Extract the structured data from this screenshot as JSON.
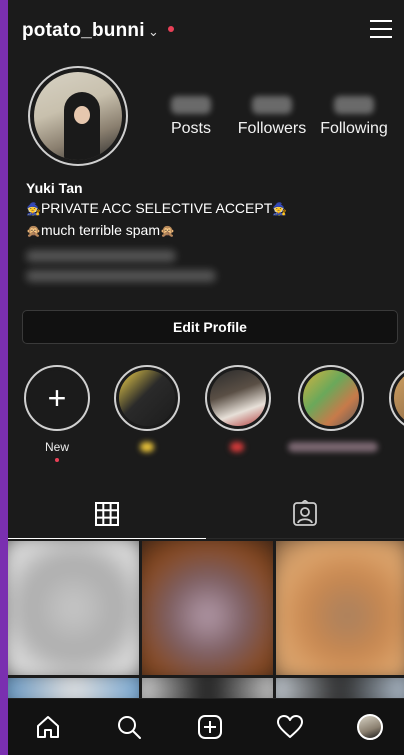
{
  "header": {
    "username": "potato_bunni",
    "caret": "⌄"
  },
  "stats": {
    "posts_label": "Posts",
    "followers_label": "Followers",
    "following_label": "Following"
  },
  "bio": {
    "name": "Yuki Tan",
    "line1": "PRIVATE ACC SELECTIVE ACCEPT",
    "line2": "much terrible spam"
  },
  "actions": {
    "edit_profile_label": "Edit Profile"
  },
  "highlights": {
    "new_label": "New"
  },
  "tabs": {
    "grid": "grid-icon",
    "tagged": "tagged-icon"
  },
  "colors": {
    "background": "#1b1b1b",
    "outer": "#7a2fb0",
    "notification_dot": "#e94057"
  }
}
